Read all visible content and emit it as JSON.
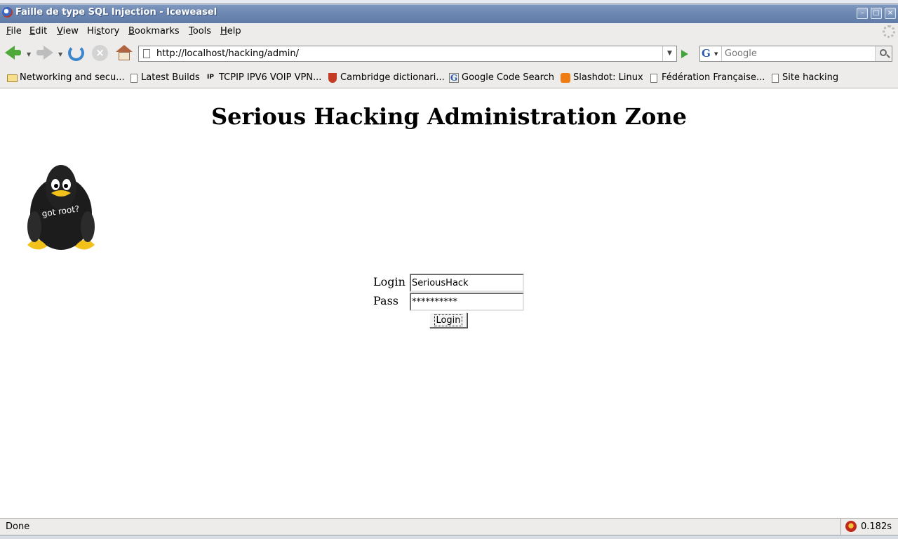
{
  "window": {
    "title": "Faille de type SQL Injection - Iceweasel"
  },
  "menu": {
    "items": [
      {
        "accel": "F",
        "rest": "ile"
      },
      {
        "accel": "E",
        "rest": "dit"
      },
      {
        "accel": "V",
        "rest": "iew"
      },
      {
        "pre": "Hi",
        "accel": "s",
        "rest": "tory"
      },
      {
        "accel": "B",
        "rest": "ookmarks"
      },
      {
        "accel": "T",
        "rest": "ools"
      },
      {
        "accel": "H",
        "rest": "elp"
      }
    ]
  },
  "navigation": {
    "url": "http://localhost/hacking/admin/",
    "search_placeholder": "Google",
    "search_engine_letter": "G"
  },
  "bookmarks": {
    "items": [
      {
        "label": "Networking and secu...",
        "icon": "folder-icon"
      },
      {
        "label": "Latest Builds",
        "icon": "page-icon"
      },
      {
        "label": "TCPIP IPV6 VOIP VPN...",
        "icon": "ip-icon",
        "icon_text": "IP"
      },
      {
        "label": "Cambridge dictionari...",
        "icon": "cambridge-shield-icon"
      },
      {
        "label": "Google Code Search",
        "icon": "google-icon",
        "icon_text": "G"
      },
      {
        "label": "Slashdot: Linux",
        "icon": "rss-feed-icon"
      },
      {
        "label": "Fédération Française...",
        "icon": "page-icon"
      },
      {
        "label": "Site hacking",
        "icon": "page-icon"
      }
    ]
  },
  "page": {
    "heading": "Serious Hacking Administration Zone",
    "mascot_text": "got root?",
    "form": {
      "login_label": "Login",
      "login_value": "SeriousHack",
      "pass_label": "Pass",
      "pass_value": "**********",
      "submit_label": "Login"
    }
  },
  "status": {
    "text": "Done",
    "timer": "0.182s"
  },
  "colors": {
    "titlebar": "#6b86b0",
    "chrome": "#edeceb",
    "go_green": "#43a63a"
  }
}
